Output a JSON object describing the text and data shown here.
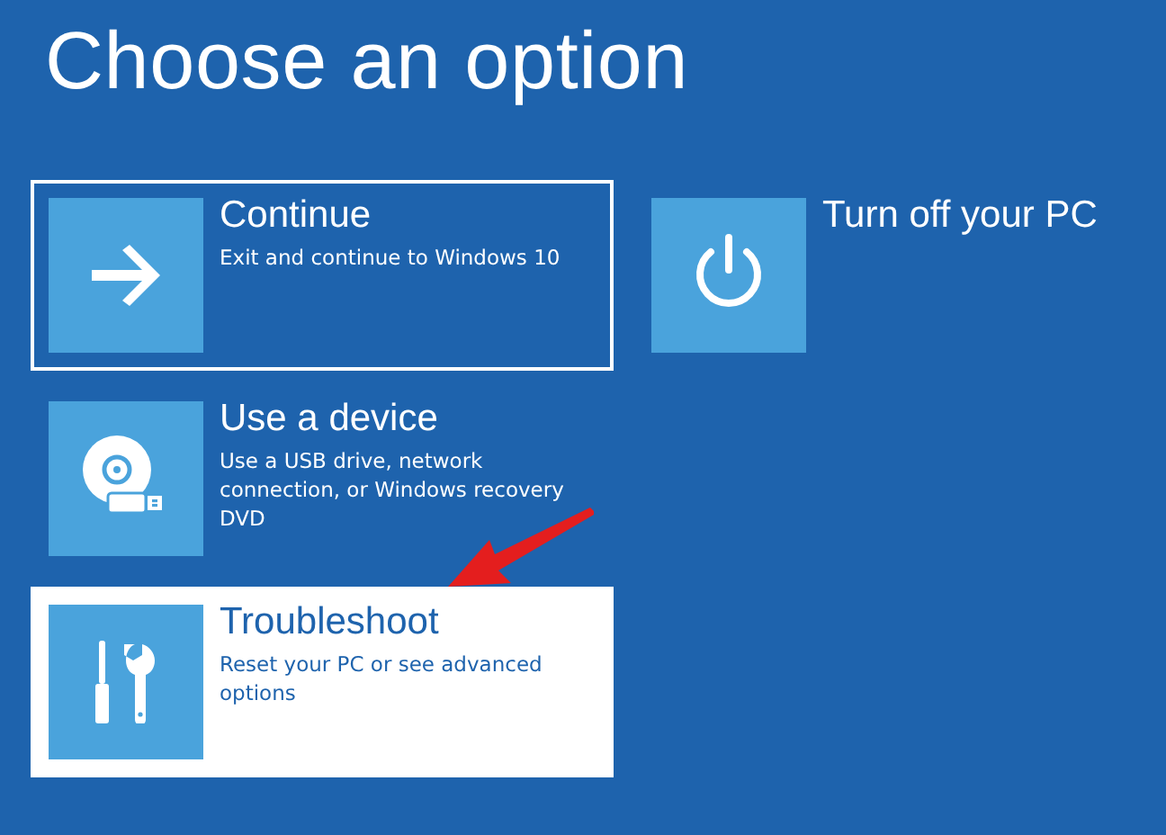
{
  "title": "Choose an option",
  "columns": [
    {
      "options": [
        {
          "kind": "arrow",
          "label": "Continue",
          "description": "Exit and continue to Windows 10",
          "focused": true,
          "selected": false
        },
        {
          "kind": "device",
          "label": "Use a device",
          "description": "Use a USB drive, network connection, or Windows recovery DVD",
          "focused": false,
          "selected": false
        },
        {
          "kind": "tools",
          "label": "Troubleshoot",
          "description": "Reset your PC or see advanced options",
          "focused": false,
          "selected": true
        }
      ]
    },
    {
      "options": [
        {
          "kind": "power",
          "label": "Turn off your PC",
          "focused": false,
          "selected": false
        }
      ]
    }
  ],
  "annotation": {
    "kind": "arrow"
  }
}
